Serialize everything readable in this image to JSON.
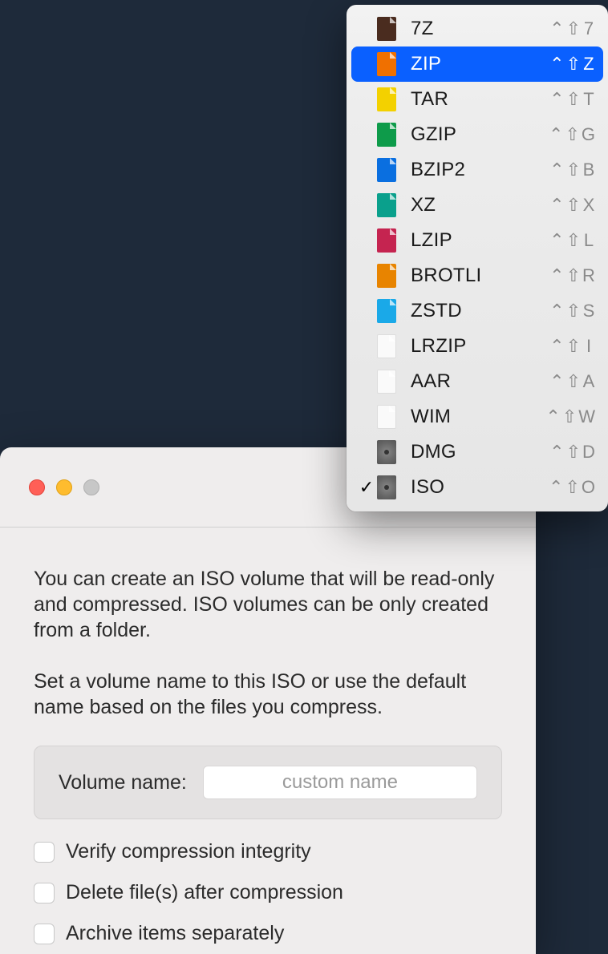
{
  "dropdown": {
    "items": [
      {
        "label": "7Z",
        "shortcut": "7",
        "icon_color": "#4a2c1f",
        "selected": false,
        "checked": false,
        "icon_type": "file"
      },
      {
        "label": "ZIP",
        "shortcut": "Z",
        "icon_color": "#f07000",
        "selected": true,
        "checked": false,
        "icon_type": "file"
      },
      {
        "label": "TAR",
        "shortcut": "T",
        "icon_color": "#f3d100",
        "selected": false,
        "checked": false,
        "icon_type": "file"
      },
      {
        "label": "GZIP",
        "shortcut": "G",
        "icon_color": "#0e9b4a",
        "selected": false,
        "checked": false,
        "icon_type": "file"
      },
      {
        "label": "BZIP2",
        "shortcut": "B",
        "icon_color": "#0a6fe0",
        "selected": false,
        "checked": false,
        "icon_type": "file"
      },
      {
        "label": "XZ",
        "shortcut": "X",
        "icon_color": "#0aa08c",
        "selected": false,
        "checked": false,
        "icon_type": "file"
      },
      {
        "label": "LZIP",
        "shortcut": "L",
        "icon_color": "#c52450",
        "selected": false,
        "checked": false,
        "icon_type": "file"
      },
      {
        "label": "BROTLI",
        "shortcut": "R",
        "icon_color": "#e88400",
        "selected": false,
        "checked": false,
        "icon_type": "file"
      },
      {
        "label": "ZSTD",
        "shortcut": "S",
        "icon_color": "#1aa9e8",
        "selected": false,
        "checked": false,
        "icon_type": "file"
      },
      {
        "label": "LRZIP",
        "shortcut": "I",
        "icon_color": "#fafafa",
        "selected": false,
        "checked": false,
        "icon_type": "white"
      },
      {
        "label": "AAR",
        "shortcut": "A",
        "icon_color": "#fafafa",
        "selected": false,
        "checked": false,
        "icon_type": "white"
      },
      {
        "label": "WIM",
        "shortcut": "W",
        "icon_color": "#fafafa",
        "selected": false,
        "checked": false,
        "icon_type": "white"
      },
      {
        "label": "DMG",
        "shortcut": "D",
        "icon_color": "#777777",
        "selected": false,
        "checked": false,
        "icon_type": "disc"
      },
      {
        "label": "ISO",
        "shortcut": "O",
        "icon_color": "#777777",
        "selected": false,
        "checked": true,
        "icon_type": "disc"
      }
    ],
    "shortcut_prefix_ctrl": "⌃",
    "shortcut_prefix_shift": "⇧"
  },
  "dialog": {
    "paragraph1": "You can create an ISO volume that will be read-only and compressed. ISO volumes can be only created from a folder.",
    "paragraph2": "Set a volume name to this ISO or use the default name based on the files you compress.",
    "volume_label": "Volume name:",
    "volume_placeholder": "custom name",
    "volume_value": "",
    "check1": "Verify compression integrity",
    "check2": "Delete file(s) after compression",
    "check3": "Archive items separately"
  }
}
